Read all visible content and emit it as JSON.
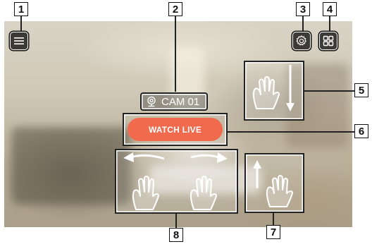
{
  "callouts": [
    "1",
    "2",
    "3",
    "4",
    "5",
    "6",
    "7",
    "8"
  ],
  "camera": {
    "name": "CAM 01"
  },
  "watch_live": {
    "label": "WATCH LIVE",
    "color": "#f26a4e"
  },
  "icons": {
    "menu": "hamburger-menu-icon",
    "settings": "gear-icon",
    "layout": "grid-layout-icon",
    "camera": "camera-icon"
  },
  "gestures": {
    "swipe_down": "hand swipe down",
    "swipe_up": "hand swipe up",
    "swipe_left_right": "hand swipe left and right"
  }
}
